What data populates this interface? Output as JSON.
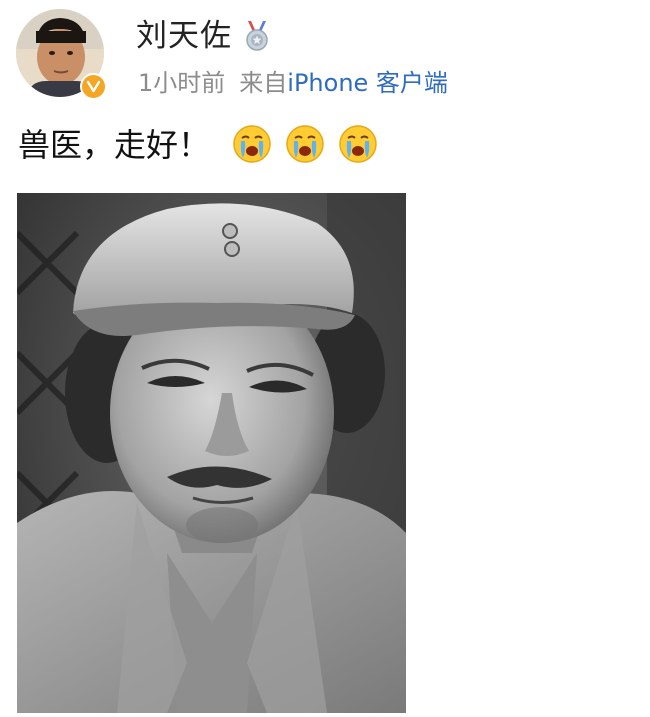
{
  "post": {
    "author": {
      "name": "刘天佐",
      "avatar_icon": "user-avatar-photo",
      "verified_icon": "verified-badge-icon",
      "badge_icon": "medal-icon"
    },
    "meta": {
      "time": "1小时前",
      "from_label": "来自",
      "source": "iPhone 客户端"
    },
    "text": "兽医，走好！",
    "emojis": [
      "crying-face-emoji",
      "crying-face-emoji",
      "crying-face-emoji"
    ],
    "image": {
      "description_icon": "portrait-photo"
    }
  },
  "colors": {
    "name": "#222222",
    "meta": "#8c8c8c",
    "source_link": "#2f6bbf",
    "verified": "#f5a623"
  }
}
